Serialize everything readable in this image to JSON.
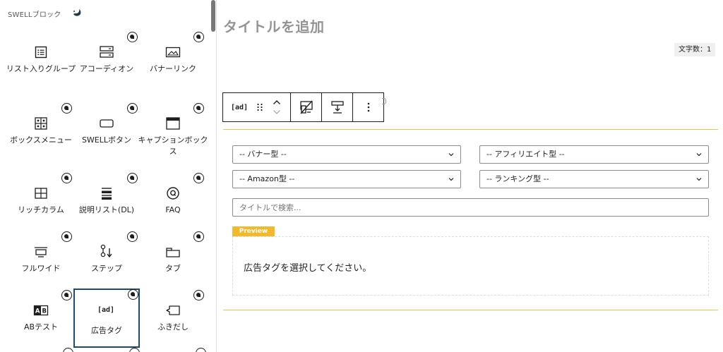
{
  "panel": {
    "title": "SWELLブロック",
    "blocks": [
      {
        "label": "リスト入りグループ",
        "icon": "list-icon",
        "badge": false
      },
      {
        "label": "アコーディオン",
        "icon": "accordion-icon",
        "badge": true
      },
      {
        "label": "バナーリンク",
        "icon": "banner-image-icon",
        "badge": true
      },
      {
        "label": "ボックスメニュー",
        "icon": "box-menu-icon",
        "badge": true
      },
      {
        "label": "SWELLボタン",
        "icon": "button-icon",
        "badge": true
      },
      {
        "label": "キャプションボックス",
        "icon": "caption-box-icon",
        "badge": true
      },
      {
        "label": "リッチカラム",
        "icon": "columns-icon",
        "badge": true
      },
      {
        "label": "説明リスト(DL)",
        "icon": "dl-list-icon",
        "badge": true
      },
      {
        "label": "FAQ",
        "icon": "faq-icon",
        "badge": true
      },
      {
        "label": "フルワイド",
        "icon": "full-wide-icon",
        "badge": true
      },
      {
        "label": "ステップ",
        "icon": "step-icon",
        "badge": true
      },
      {
        "label": "タブ",
        "icon": "tab-icon",
        "badge": true
      },
      {
        "label": "ABテスト",
        "icon": "ab-test-icon",
        "badge": true
      },
      {
        "label": "広告タグ",
        "icon": "ad-tag-icon",
        "badge": true,
        "ad_text": "[ad]",
        "selected": true
      },
      {
        "label": "ふきだし",
        "icon": "speech-bubble-icon",
        "badge": true
      }
    ]
  },
  "editor": {
    "title_placeholder": "タイトルを追加",
    "char_count": "文字数：1",
    "toolbar": {
      "block_label": "[ad]",
      "drag_icon": "drag-handle-icon",
      "move_icons": [
        "chevron-up-icon",
        "chevron-down-icon"
      ],
      "tools": [
        "mobile-desktop-icon",
        "spacing-icon",
        "more-options-icon"
      ]
    },
    "selects": {
      "banner": "-- バナー型 --",
      "affiliate": "-- アフィリエイト型 --",
      "amazon": "-- Amazon型 --",
      "ranking": "-- ランキング型 --"
    },
    "search_placeholder": "タイトルで検索...",
    "preview_label": "Preview",
    "preview_text": "広告タグを選択してください。"
  },
  "colors": {
    "selected_border": "#1d4c6b",
    "accent_gold": "#f5b82a",
    "divider_gold": "#f0c04e"
  }
}
